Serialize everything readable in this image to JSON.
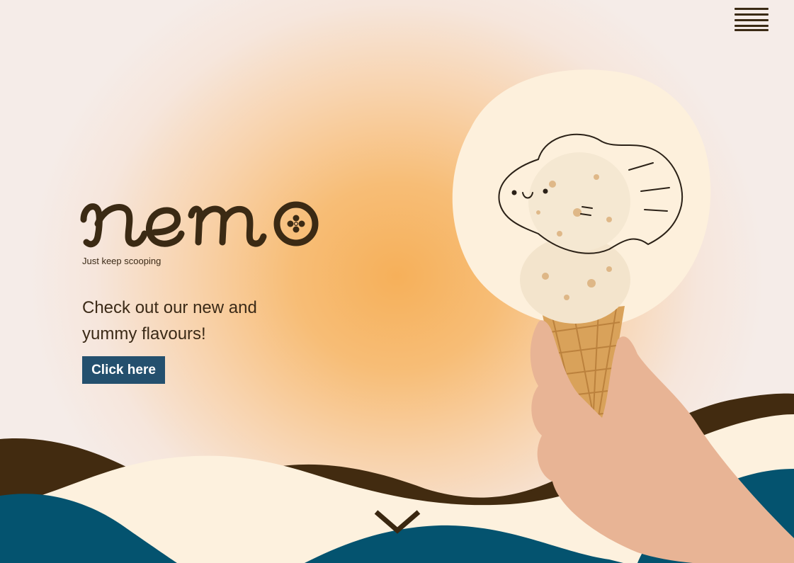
{
  "brand": {
    "logo_text": "nemo",
    "tagline": "Just keep scooping"
  },
  "hero": {
    "headline": "Check out our new and yummy flavours!",
    "cta_label": "Click here"
  },
  "icons": {
    "menu": "hamburger-menu-icon",
    "scroll": "chevron-down-icon"
  },
  "colors": {
    "dark_brown": "#422b10",
    "cream": "#fdf1de",
    "navy": "#04536f",
    "button_blue": "#24506e",
    "glow_orange": "#f6b05a"
  }
}
